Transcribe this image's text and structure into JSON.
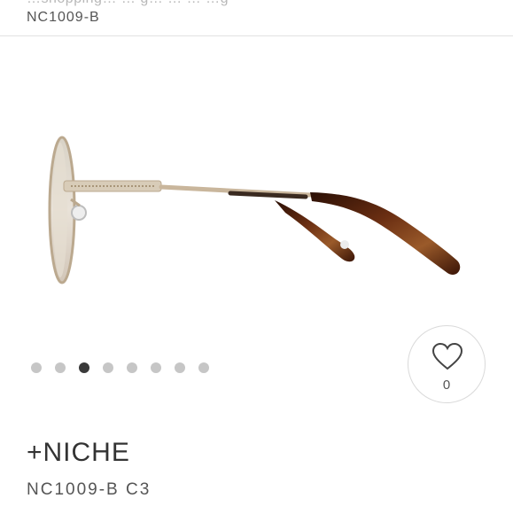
{
  "header": {
    "cut_text": "…shopping… … g… … … …g",
    "title": "NC1009-B"
  },
  "gallery": {
    "image_name": "glasses-side-view",
    "dot_count": 8,
    "active_index": 2
  },
  "like": {
    "count": "0",
    "icon": "heart-icon"
  },
  "product": {
    "brand": "+NICHE",
    "model": "NC1009-B  C3"
  },
  "colors": {
    "frame_gold": "#c9b69c",
    "tortoise": "#4a1f0d",
    "dot_inactive": "#c6c6c6",
    "dot_active": "#3a3a3a"
  }
}
